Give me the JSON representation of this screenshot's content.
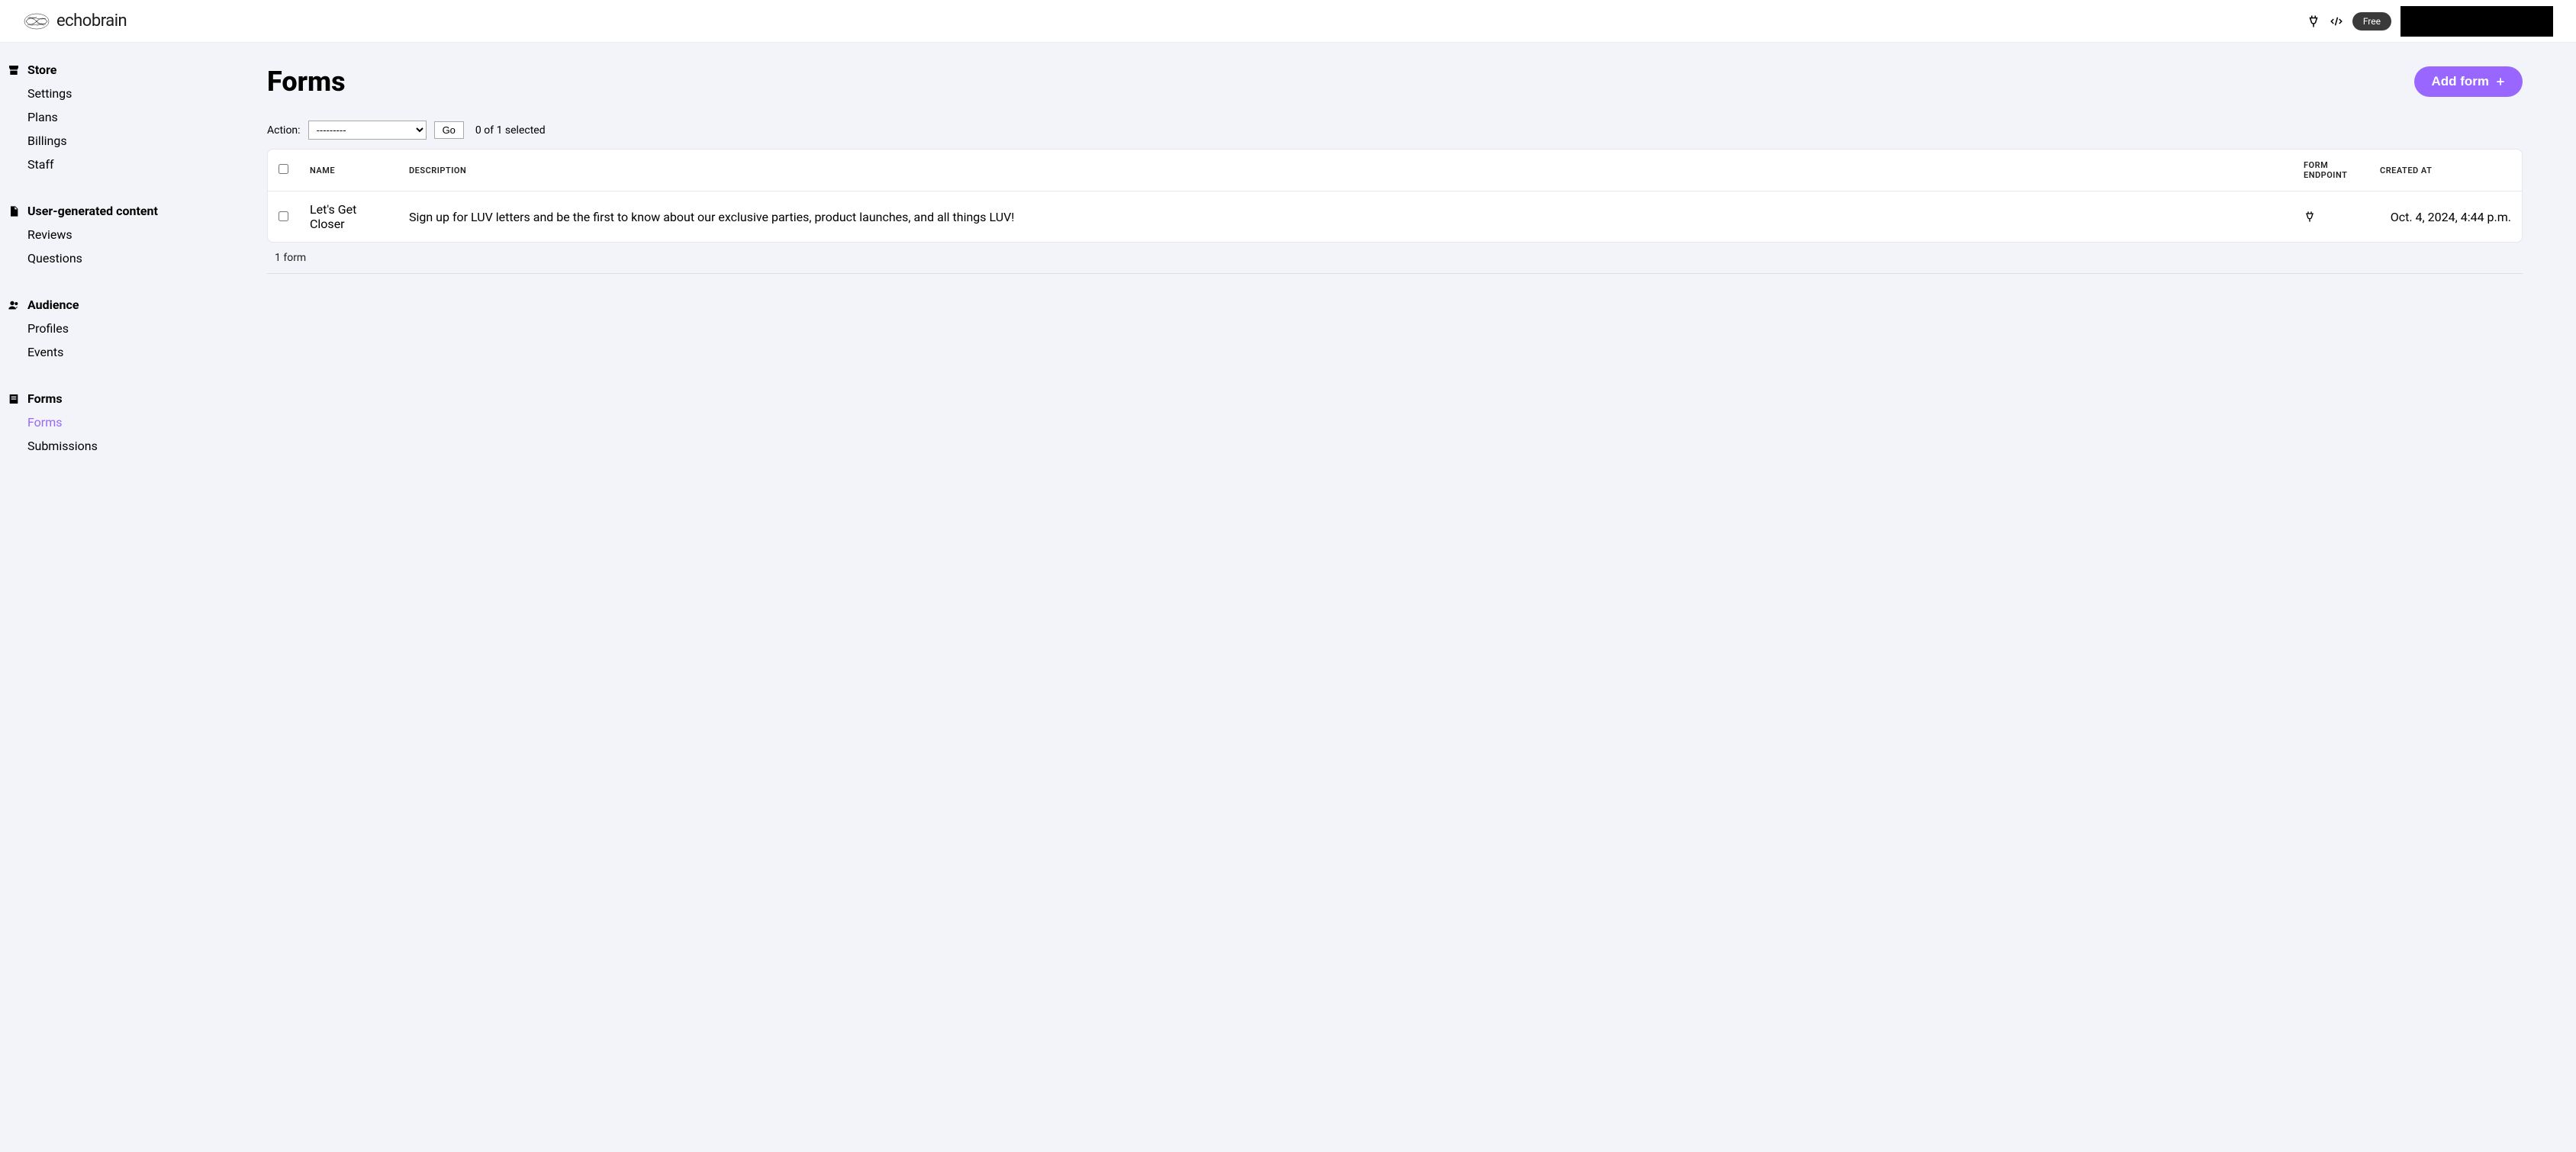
{
  "header": {
    "brand": "echobrain",
    "free_badge": "Free"
  },
  "sidebar": {
    "sections": [
      {
        "label": "Store",
        "items": [
          {
            "label": "Settings",
            "active": false
          },
          {
            "label": "Plans",
            "active": false
          },
          {
            "label": "Billings",
            "active": false
          },
          {
            "label": "Staff",
            "active": false
          }
        ]
      },
      {
        "label": "User-generated content",
        "items": [
          {
            "label": "Reviews",
            "active": false
          },
          {
            "label": "Questions",
            "active": false
          }
        ]
      },
      {
        "label": "Audience",
        "items": [
          {
            "label": "Profiles",
            "active": false
          },
          {
            "label": "Events",
            "active": false
          }
        ]
      },
      {
        "label": "Forms",
        "items": [
          {
            "label": "Forms",
            "active": true
          },
          {
            "label": "Submissions",
            "active": false
          }
        ]
      }
    ]
  },
  "main": {
    "title": "Forms",
    "add_button": "Add form",
    "action_label": "Action:",
    "action_placeholder": "---------",
    "go_label": "Go",
    "selection_text": "0 of 1 selected",
    "columns": {
      "name": "NAME",
      "description": "DESCRIPTION",
      "endpoint": "FORM ENDPOINT",
      "created": "CREATED AT"
    },
    "rows": [
      {
        "name": "Let's Get Closer",
        "description": "Sign up for LUV letters and be the first to know about our exclusive parties, product launches, and all things LUV!",
        "created": "Oct. 4, 2024, 4:44 p.m."
      }
    ],
    "footer_count": "1 form"
  }
}
